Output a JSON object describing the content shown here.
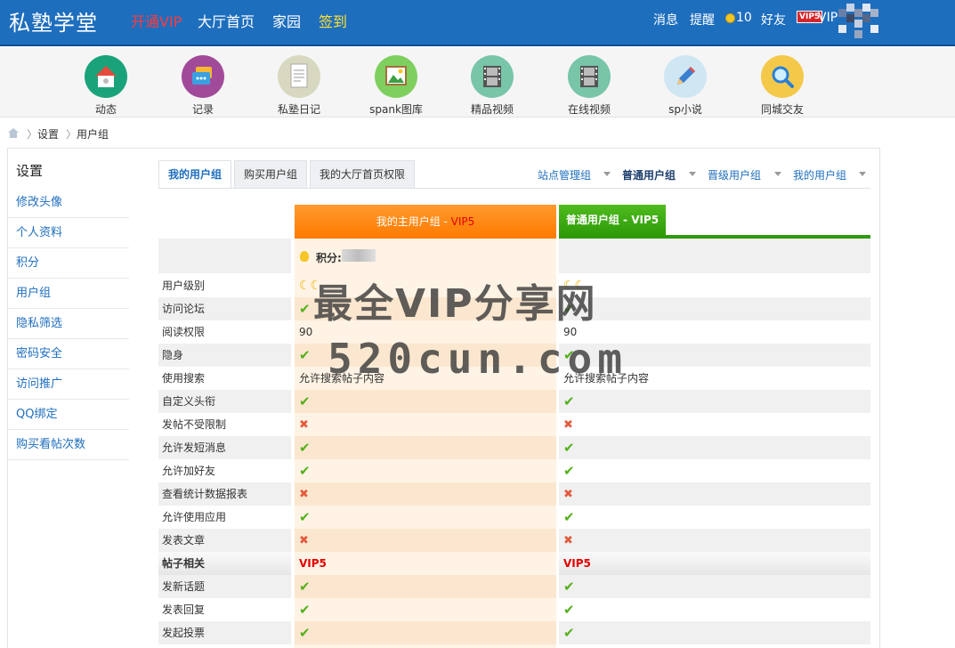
{
  "header": {
    "logo": "私塾学堂",
    "nav": {
      "vip": "开通VIP",
      "hall": "大厅首页",
      "home": "家园",
      "sign": "签到"
    },
    "right": {
      "messages": "消息",
      "remind": "提醒",
      "coins": "10",
      "friends": "好友",
      "vip_badge": "VIP5",
      "vip_text": "VIP"
    }
  },
  "iconbar": [
    {
      "label": "动态",
      "icon": "home-icon",
      "color": "#1aa37a"
    },
    {
      "label": "记录",
      "icon": "chat-icon",
      "color": "#a24a9a"
    },
    {
      "label": "私塾日记",
      "icon": "document-icon",
      "color": "#d8d8c0"
    },
    {
      "label": "spank图库",
      "icon": "image-icon",
      "color": "#7fcf5f"
    },
    {
      "label": "精品视频",
      "icon": "film-icon",
      "color": "#78c5a8"
    },
    {
      "label": "在线视频",
      "icon": "film-icon",
      "color": "#78c5a8"
    },
    {
      "label": "sp小说",
      "icon": "pencil-icon",
      "color": "#cfe6f3"
    },
    {
      "label": "同城交友",
      "icon": "magnifier-icon",
      "color": "#f4c94a"
    }
  ],
  "breadcrumb": {
    "sep": "〉",
    "settings": "设置",
    "current": "用户组"
  },
  "sidebar": {
    "title": "设置",
    "items": [
      "修改头像",
      "个人资料",
      "积分",
      "用户组",
      "隐私筛选",
      "密码安全",
      "访问推广",
      "QQ绑定",
      "购买看帖次数"
    ]
  },
  "tabs": {
    "mine": "我的用户组",
    "buy": "购买用户组",
    "hall_perm": "我的大厅首页权限"
  },
  "right_tabs": [
    "站点管理组",
    "普通用户组",
    "晋级用户组",
    "我的用户组"
  ],
  "table": {
    "head_left_prefix": "我的主用户组 - ",
    "head_left_vip": "VIP5",
    "head_right": "普通用户组 - VIP5",
    "jifen_label": "积分:",
    "rows": [
      {
        "label": "用户级别",
        "left": "☾☾",
        "right": "☾☾",
        "kind": "moon"
      },
      {
        "label": "访问论坛",
        "left": "✔",
        "right": "✔",
        "kind": "check"
      },
      {
        "label": "阅读权限",
        "left": "90",
        "right": "90",
        "kind": "text"
      },
      {
        "label": "隐身",
        "left": "✔",
        "right": "✔",
        "kind": "check"
      },
      {
        "label": "使用搜索",
        "left": "允许搜索帖子内容",
        "right": "允许搜索帖子内容",
        "kind": "text"
      },
      {
        "label": "自定义头衔",
        "left": "✔",
        "right": "✔",
        "kind": "check"
      },
      {
        "label": "发帖不受限制",
        "left": "✖",
        "right": "✖",
        "kind": "cross"
      },
      {
        "label": "允许发短消息",
        "left": "✔",
        "right": "✔",
        "kind": "check"
      },
      {
        "label": "允许加好友",
        "left": "✔",
        "right": "✔",
        "kind": "check"
      },
      {
        "label": "查看统计数据报表",
        "left": "✖",
        "right": "✖",
        "kind": "cross"
      },
      {
        "label": "允许使用应用",
        "left": "✔",
        "right": "✔",
        "kind": "check"
      },
      {
        "label": "发表文章",
        "left": "✖",
        "right": "✖",
        "kind": "cross"
      },
      {
        "label": "帖子相关",
        "left": "VIP5",
        "right": "VIP5",
        "kind": "section"
      },
      {
        "label": "发新话题",
        "left": "✔",
        "right": "✔",
        "kind": "check"
      },
      {
        "label": "发表回复",
        "left": "✔",
        "right": "✔",
        "kind": "check"
      },
      {
        "label": "发起投票",
        "left": "✔",
        "right": "✔",
        "kind": "check"
      }
    ]
  },
  "watermark": {
    "line1": "最全VIP分享网",
    "line2": "520cun.com"
  }
}
